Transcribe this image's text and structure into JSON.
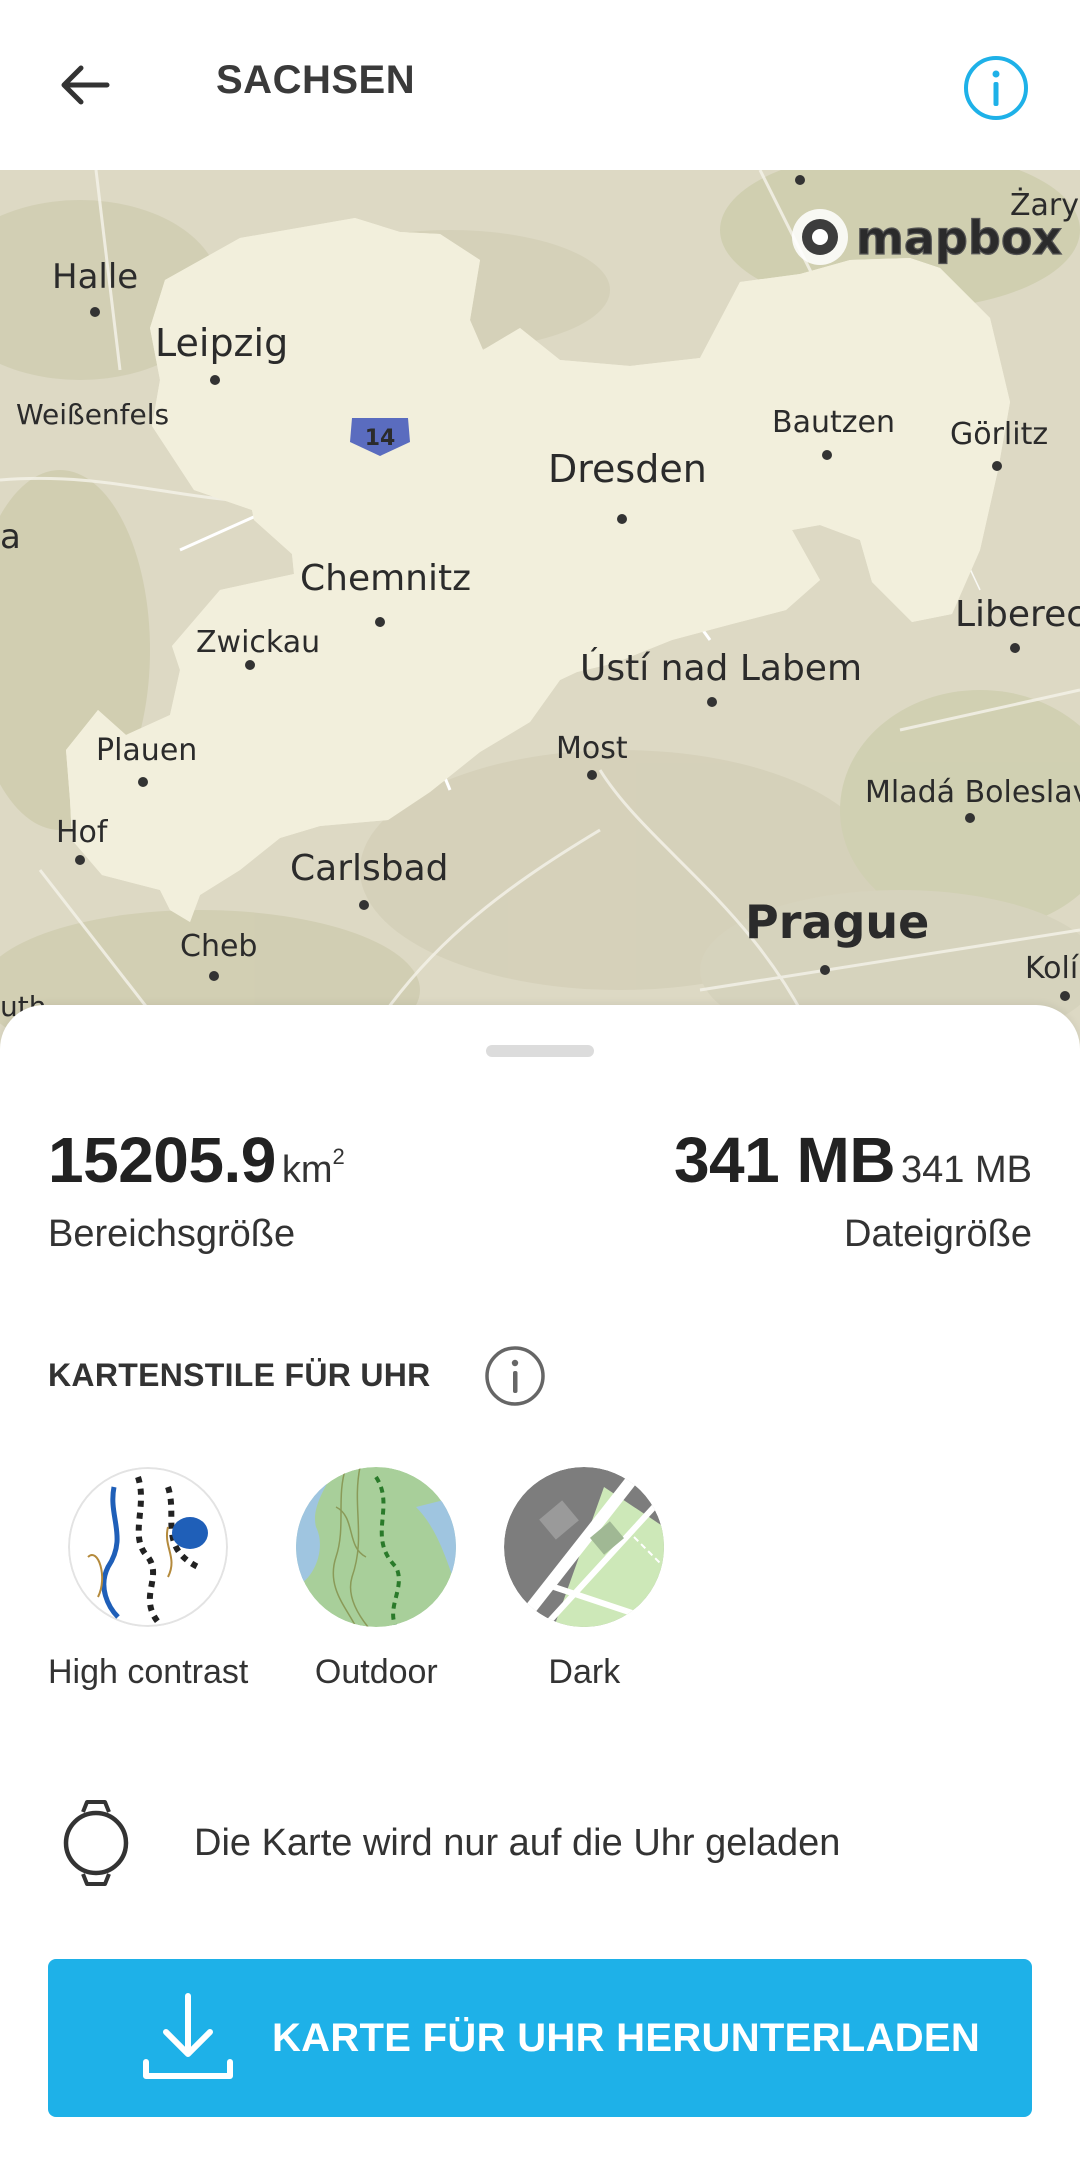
{
  "header": {
    "title": "SACHSEN",
    "back_icon": "arrow-left-icon",
    "info_icon": "info-circle-icon"
  },
  "map": {
    "attribution": "mapbox",
    "highway_shield": "14",
    "places": {
      "halle": "Halle",
      "leipzig": "Leipzig",
      "weissenfels": "Weißenfels",
      "zary": "Żary",
      "bautzen": "Bautzen",
      "goerlitz": "Görlitz",
      "dresden": "Dresden",
      "chemnitz": "Chemnitz",
      "zwickau": "Zwickau",
      "liberec": "Liberec",
      "usti": "Ústí nad Labem",
      "plauen": "Plauen",
      "most": "Most",
      "mlada": "Mladá Boleslav",
      "hof": "Hof",
      "carlsbad": "Carlsbad",
      "prague": "Prague",
      "cheb": "Cheb",
      "kolin": "Kolín",
      "edge_left": "a",
      "edge_bottom": "uth"
    },
    "colors": {
      "region_outline": "#2aa8e0",
      "map_base": "#ddd9c4"
    }
  },
  "stats": {
    "area_value": "15205.9",
    "area_unit": "km",
    "area_unit_sup": "2",
    "area_label": "Bereichsgröße",
    "size_value": "341 MB",
    "size_unit": "341 MB",
    "size_label": "Dateigröße"
  },
  "styles_section": {
    "title": "KARTENSTILE FÜR UHR",
    "items": [
      {
        "label": "High contrast",
        "icon": "high-contrast-style-thumbnail"
      },
      {
        "label": "Outdoor",
        "icon": "outdoor-style-thumbnail"
      },
      {
        "label": "Dark",
        "icon": "dark-style-thumbnail"
      }
    ]
  },
  "note": {
    "text": "Die Karte wird nur auf die Uhr geladen",
    "icon": "watch-icon"
  },
  "download": {
    "label": "KARTE FÜR UHR HERUNTERLADEN",
    "icon": "download-icon",
    "color": "#1eb1e8"
  }
}
